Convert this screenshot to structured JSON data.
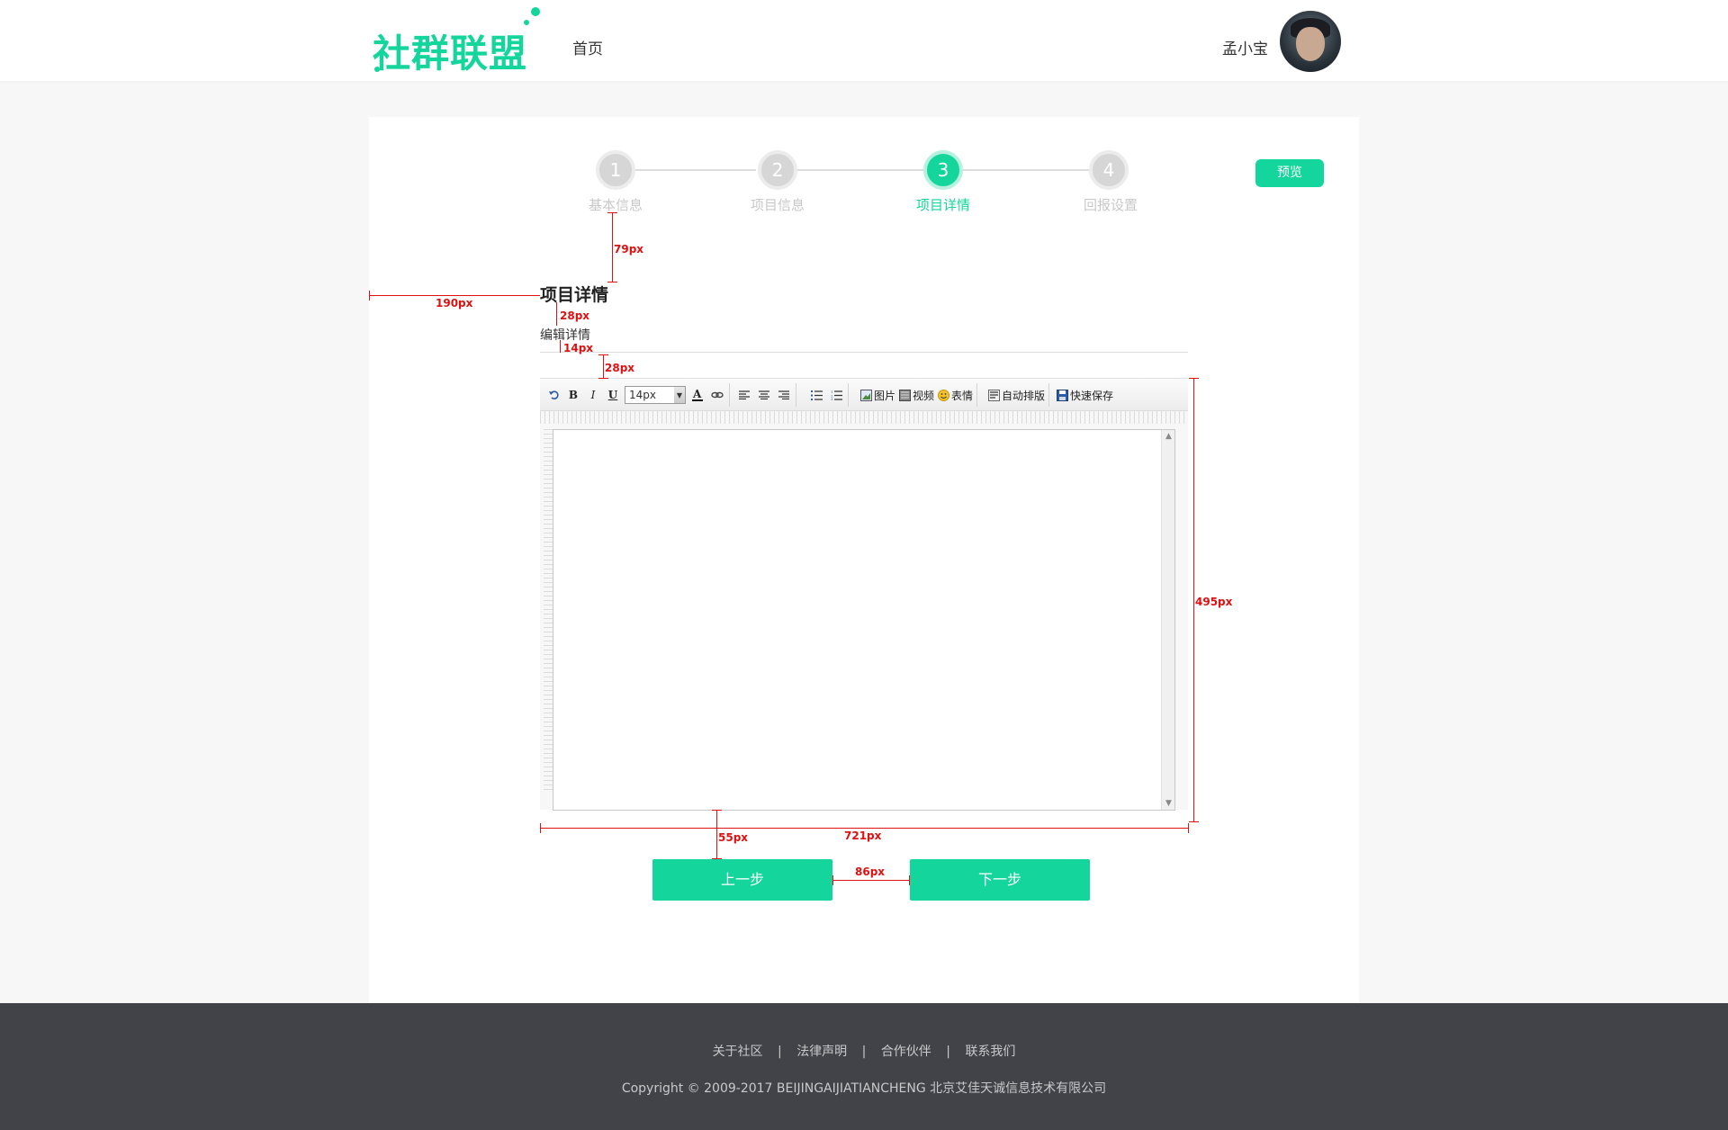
{
  "header": {
    "logo_text": "社群联盟",
    "nav_home": "首页",
    "username": "孟小宝"
  },
  "steps": [
    {
      "num": "1",
      "label": "基本信息",
      "active": false
    },
    {
      "num": "2",
      "label": "项目信息",
      "active": false
    },
    {
      "num": "3",
      "label": "项目详情",
      "active": true
    },
    {
      "num": "4",
      "label": "回报设置",
      "active": false
    }
  ],
  "preview_label": "预览",
  "section": {
    "title": "项目详情",
    "subtitle": "编辑详情"
  },
  "toolbar": {
    "font_size": "14px",
    "image": "图片",
    "video": "视频",
    "emoji": "表情",
    "auto_layout": "自动排版",
    "quick_save": "快速保存"
  },
  "buttons": {
    "prev": "上一步",
    "next": "下一步"
  },
  "annotations": {
    "a79": "79px",
    "a190": "190px",
    "a28a": "28px",
    "a14": "14px",
    "a28b": "28px",
    "a495": "495px",
    "a55": "55px",
    "a721": "721px",
    "a86": "86px"
  },
  "footer": {
    "links": [
      "关于社区",
      "法律声明",
      "合作伙伴",
      "联系我们"
    ],
    "separator": "|",
    "copyright": "Copyright © 2009-2017 BEIJINGAIJIATIANCHENG 北京艾佳天诚信息技术有限公司"
  },
  "colors": {
    "accent": "#14d59c",
    "annotation": "#e01010",
    "footer_bg": "#424348"
  }
}
